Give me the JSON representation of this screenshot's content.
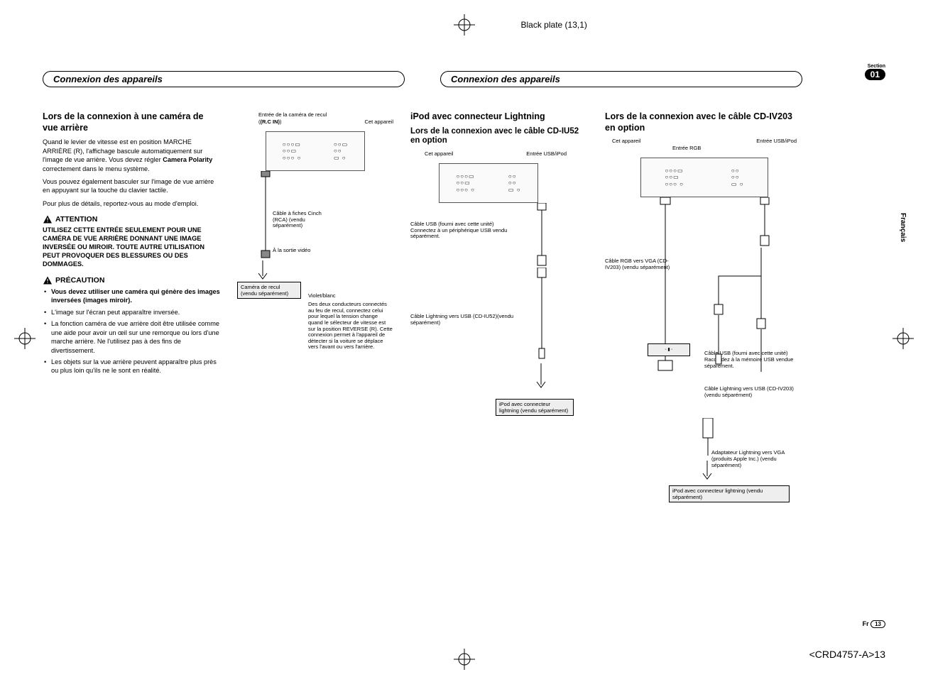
{
  "plate": "Black plate (13,1)",
  "header_left": "Connexion des appareils",
  "header_right": "Connexion des appareils",
  "section_label": "Section",
  "section_num": "01",
  "lang_tab": "Français",
  "col1": {
    "h3": "Lors de la connexion à une caméra de vue arrière",
    "p1": "Quand le levier de vitesse est en position MARCHE ARRIÈRE (R), l'affichage bascule automatiquement sur l'image de vue arrière. Vous devez régler ",
    "p1_bold": "Camera Polarity",
    "p1_after": " correctement dans le menu système.",
    "p2": "Vous pouvez également basculer sur l'image de vue arrière en appuyant sur la touche du clavier tactile.",
    "p3": "Pour plus de détails, reportez-vous au mode d'emploi.",
    "attention": "ATTENTION",
    "attention_body": "UTILISEZ CETTE ENTRÉE SEULEMENT POUR UNE CAMÉRA DE VUE ARRIÈRE DONNANT UNE IMAGE INVERSÉE OU MIROIR. TOUTE AUTRE UTILISATION PEUT PROVOQUER DES BLESSURES OU DES DOMMAGES.",
    "precaution": "PRÉCAUTION",
    "prec_items": [
      "Vous devez utiliser une caméra qui génère des images inversées (images miroir).",
      "L'image sur l'écran peut apparaître inversée.",
      "La fonction caméra de vue arrière doit être utilisée comme une aide pour avoir un œil sur une remorque ou lors d'une marche arrière. Ne l'utilisez pas à des fins de divertissement.",
      "Les objets sur la vue arrière peuvent apparaître plus près ou plus loin qu'ils ne le sont en réalité."
    ]
  },
  "col2": {
    "top1": "Entrée de la caméra de recul",
    "top2": "(R.C IN)",
    "top3": "Cet appareil",
    "cable_rca": "Câble à fiches Cinch (RCA) (vendu séparément)",
    "to_video": "À la sortie vidéo",
    "cam_box": "Caméra de recul (vendu séparément)",
    "violet": "Violet/blanc",
    "violet_body": "Des deux conducteurs connectés au feu de recul, connectez celui pour lequel la tension change quand le sélecteur de vitesse est sur la position REVERSE (R). Cette connexion permet à l'appareil de détecter si la voiture se déplace vers l'avant ou vers l'arrière."
  },
  "col3": {
    "h3": "iPod avec connecteur Lightning",
    "h4": "Lors de la connexion avec le câble CD-IU52 en option",
    "l_app": "Cet appareil",
    "l_usb": "Entrée USB/iPod",
    "usb_cable": "Câble USB (fourni avec cette unité) Connectez à un périphérique USB vendu séparément.",
    "lightning_cable": "Câble Lightning vers USB (CD-IU52)(vendu séparément)",
    "ipod_box": "iPod avec connecteur lightning (vendu séparément)"
  },
  "col4": {
    "h3": "Lors de la connexion avec le câble CD-IV203 en option",
    "l_app": "Cet appareil",
    "l_rgb": "Entrée RGB",
    "l_usb": "Entrée USB/iPod",
    "rgb_cable": "Câble RGB vers VGA (CD-IV203) (vendu séparément)",
    "usb_cable": "Câble USB (fourni avec cette unité) Raccordez à la mémoire USB vendue séparément.",
    "lightning_usb": "Câble Lightning vers USB (CD-IV203) (vendu séparément)",
    "adapter": "Adaptateur Lightning vers VGA (produits Apple Inc.) (vendu séparément)",
    "ipod_box": "iPod avec connecteur lightning (vendu séparément)"
  },
  "footer_lang": "Fr",
  "footer_page": "13",
  "footer_doc": "<CRD4757-A>13"
}
